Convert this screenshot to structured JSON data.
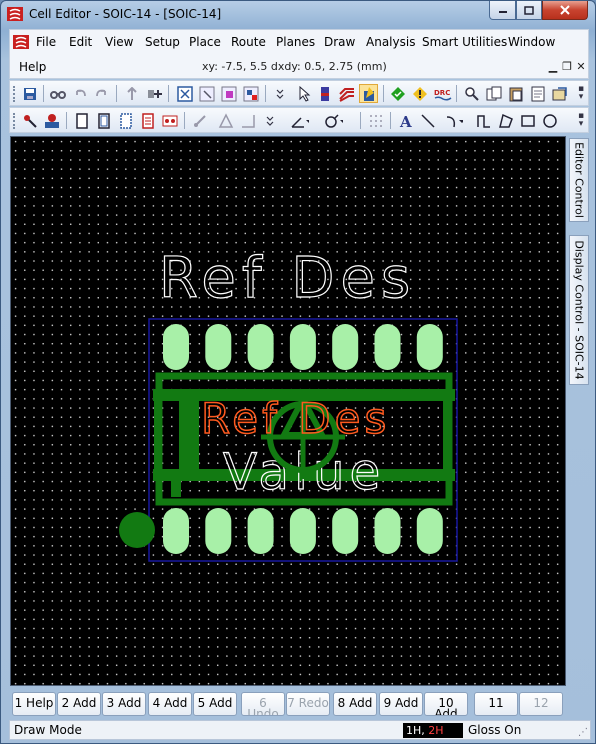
{
  "window": {
    "title": "Cell Editor - SOIC-14 - [SOIC-14]",
    "minimize_icon": "minimize-icon",
    "maximize_icon": "maximize-icon",
    "close_icon": "close-icon"
  },
  "menu": {
    "items": [
      "File",
      "Edit",
      "View",
      "Setup",
      "Place",
      "Route",
      "Planes",
      "Draw",
      "Analysis",
      "Smart Utilities",
      "Window"
    ],
    "help": "Help",
    "coords": "xy: -7.5, 5.5  dxdy: 0.5, 2.75  (mm)"
  },
  "toolbar1": {
    "icons": [
      "save-icon",
      "find-icon",
      "undo-icon",
      "redo-icon",
      "move-icon",
      "add-pin-icon",
      "zoom-fit-icon",
      "zoom-window-icon",
      "zoom-in-icon",
      "zoom-out-icon",
      "select-icon",
      "layer-icon",
      "route-icon",
      "highlight-icon",
      "drc-on-icon",
      "drc-warn-icon",
      "drc-icon",
      "find-text-icon",
      "copy-icon",
      "paste-icon",
      "properties-icon",
      "settings-icon"
    ],
    "drc_label": "DRC"
  },
  "toolbar2": {
    "icons": [
      "place-part-icon",
      "place-refdes-icon",
      "new-page-icon",
      "copy-page-icon",
      "frame-icon",
      "grid-icon",
      "pin-icon",
      "move-angle-icon",
      "rotate-icon",
      "angle-icon",
      "snap-icon",
      "grid-toggle-icon",
      "text-icon",
      "line-icon",
      "arc-icon",
      "path-icon",
      "polygon-icon",
      "rectangle-icon",
      "circle-icon"
    ]
  },
  "canvas": {
    "refdes_white": "Ref Des",
    "refdes_orange": "Ref Des",
    "value_text": "Value",
    "pin_count_per_row": 7,
    "colors": {
      "background": "#000000",
      "pad": "#a8f0a8",
      "silk": "#127a12",
      "outline": "#1818a0",
      "refdes_orange": "#ff5a1f",
      "text_white": "#ffffff"
    }
  },
  "side_tabs": {
    "editor_control": "Editor Control",
    "display_control": "Display Control - SOIC-14"
  },
  "function_keys": [
    {
      "label": "1 Help",
      "sub": "",
      "enabled": true
    },
    {
      "label": "2 Add",
      "sub": "",
      "enabled": true
    },
    {
      "label": "3 Add",
      "sub": "",
      "enabled": true
    },
    {
      "label": "4 Add",
      "sub": "",
      "enabled": true
    },
    {
      "label": "5 Add",
      "sub": "",
      "enabled": true
    },
    {
      "label": "6 Undo",
      "sub": "",
      "enabled": false
    },
    {
      "label": "7 Redo",
      "sub": "",
      "enabled": false
    },
    {
      "label": "8 Add",
      "sub": "",
      "enabled": true
    },
    {
      "label": "9 Add",
      "sub": "",
      "enabled": true
    },
    {
      "label": "10 Add",
      "sub": "",
      "enabled": true
    },
    {
      "label": "11",
      "sub": "",
      "enabled": true
    },
    {
      "label": "12",
      "sub": "",
      "enabled": false
    }
  ],
  "status": {
    "mode": "Draw Mode",
    "layers_1h": "1H,",
    "layers_2h": "2H",
    "gloss": "Gloss On"
  }
}
